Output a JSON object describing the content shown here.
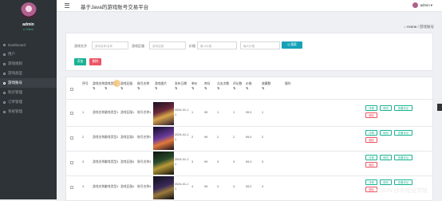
{
  "app": {
    "title": "基于Java的游戏账号交易平台",
    "admin_label": "admin"
  },
  "sidebar": {
    "user_name": "admin",
    "user_status": "● Online",
    "items": [
      {
        "label": "Dashboard",
        "icon": "dashboard-icon"
      },
      {
        "label": "用户",
        "icon": "user-icon"
      },
      {
        "label": "游戏规则",
        "icon": "rule-icon"
      },
      {
        "label": "游戏类型",
        "icon": "type-icon"
      },
      {
        "label": "游戏账号",
        "icon": "account-icon",
        "active": true
      },
      {
        "label": "购买管理",
        "icon": "cart-icon"
      },
      {
        "label": "订单管理",
        "icon": "order-icon"
      },
      {
        "label": "系统管理",
        "icon": "system-icon"
      }
    ]
  },
  "breadcrumb": {
    "home": "Home",
    "current": "游戏账号"
  },
  "search": {
    "f1_label": "游戏名字",
    "f1_placeholder": "游戏名称/名称",
    "f2_label": "游戏区服",
    "f2_placeholder": "游戏区服",
    "f3_label": "价格",
    "f3_min_placeholder": "最小价格",
    "f3_max_placeholder": "最大价格",
    "search_btn": "Q 搜索",
    "add_btn": "添加",
    "delete_btn": "删除"
  },
  "table": {
    "headers": [
      [
        "序号"
      ],
      [
        "游戏名称",
        "⇅"
      ],
      [
        "游戏类型",
        "⇅"
      ],
      [
        "游戏区服",
        "⇅"
      ],
      [
        "账号名称",
        "⇅"
      ],
      [
        "游戏图片",
        "⇅"
      ],
      [
        "发布日期",
        "⇅"
      ],
      [
        "单价",
        "⇅"
      ],
      [
        "库存",
        "⇅"
      ],
      [
        "点击次数",
        "⇅"
      ],
      [
        "评论数",
        "⇅"
      ],
      [
        "价格",
        "⇅"
      ],
      [
        "收藏数",
        "⇅"
      ],
      [
        "操作"
      ]
    ],
    "rows": [
      {
        "no": "1",
        "name": "游戏名称1",
        "type": "游戏类型1",
        "server": "游戏区服1",
        "acct": "账号名称1",
        "date": "2024-01-1\n1",
        "unit": "1",
        "stock": "99",
        "clicks": "1",
        "comments": "1",
        "price": "99.0",
        "fav": "1"
      },
      {
        "no": "2",
        "name": "游戏名称2",
        "type": "游戏类型2",
        "server": "游戏区服2",
        "acct": "账号名称2",
        "date": "2024-01-1\n1",
        "unit": "2",
        "stock": "99",
        "clicks": "2",
        "comments": "2",
        "price": "99.0",
        "fav": "2"
      },
      {
        "no": "3",
        "name": "游戏名称3",
        "type": "游戏类型3",
        "server": "游戏区服3",
        "acct": "账号名称3",
        "date": "2024-01-1\n1",
        "unit": "3",
        "stock": "99",
        "clicks": "3",
        "comments": "3",
        "price": "99.0",
        "fav": "3"
      },
      {
        "no": "4",
        "name": "游戏名称4",
        "type": "游戏类型4",
        "server": "游戏区服4",
        "acct": "账号名称4",
        "date": "2024-01-1\n1",
        "unit": "4",
        "stock": "99",
        "clicks": "4",
        "comments": "4",
        "price": "99.0",
        "fav": "4"
      }
    ],
    "actions": {
      "detail": "详情",
      "edit": "修改",
      "comment": "查看评论",
      "delete": "删除"
    }
  },
  "watermark": "CSDN @毕程设学姐"
}
